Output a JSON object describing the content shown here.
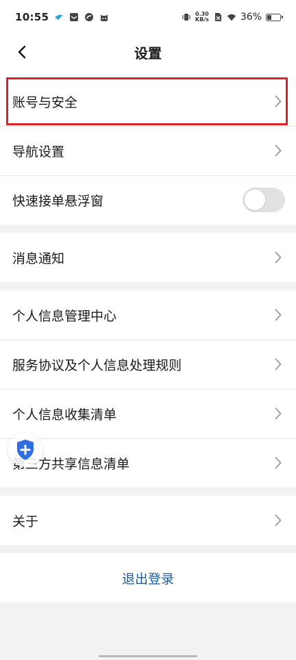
{
  "status_bar": {
    "time": "10:55",
    "net_speed_value": "0.30",
    "net_speed_unit": "KB/s",
    "battery_percent": "36%",
    "battery_level": 0.36,
    "left_icons": [
      "bird-icon",
      "mail-icon",
      "swirl-icon",
      "cat-icon"
    ],
    "right_icons": [
      "vibrate-icon",
      "sim-off-icon",
      "wifi-icon",
      "battery-icon"
    ]
  },
  "nav": {
    "title": "设置",
    "back_icon": "chevron-left-icon"
  },
  "groups": {
    "account": {
      "account_security": "账号与安全",
      "navigation_settings": "导航设置",
      "quick_order_float": "快速接单悬浮窗",
      "quick_order_float_enabled": false
    },
    "notifications": {
      "message_notification": "消息通知"
    },
    "privacy": {
      "personal_info_center": "个人信息管理中心",
      "service_agreement": "服务协议及个人信息处理规则",
      "personal_info_list": "个人信息收集清单",
      "third_party_list": "第三方共享信息清单"
    },
    "about": {
      "about": "关于"
    }
  },
  "logout": {
    "label": "退出登录"
  },
  "colors": {
    "highlight": "#d9232a",
    "logout_text": "#1d5c99",
    "shield": "#2f6fe0",
    "background": "#f2f2f2"
  },
  "floating_button": {
    "icon": "shield-plus-icon"
  }
}
